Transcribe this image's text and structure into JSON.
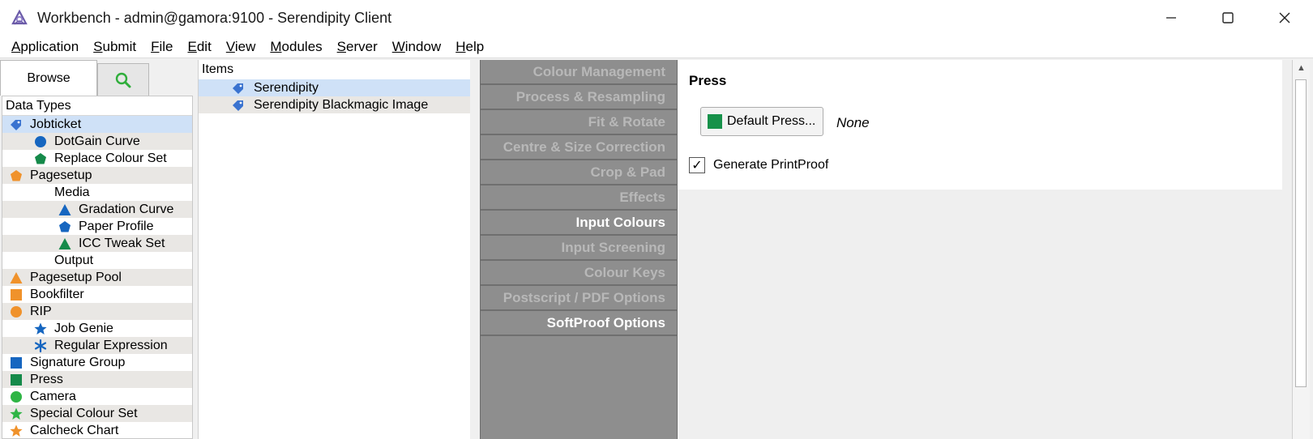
{
  "window": {
    "title": "Workbench - admin@gamora:9100 - Serendipity Client"
  },
  "menu": [
    {
      "u": "A",
      "rest": "pplication"
    },
    {
      "u": "S",
      "rest": "ubmit"
    },
    {
      "u": "F",
      "rest": "ile"
    },
    {
      "u": "E",
      "rest": "dit"
    },
    {
      "u": "V",
      "rest": "iew"
    },
    {
      "u": "M",
      "rest": "odules"
    },
    {
      "u": "S",
      "rest": "erver"
    },
    {
      "u": "W",
      "rest": "indow"
    },
    {
      "u": "H",
      "rest": "elp"
    }
  ],
  "tabs": {
    "browse": "Browse"
  },
  "types": {
    "header": "Data Types",
    "rows": [
      {
        "label": "Jobticket",
        "icon": "tag-icon",
        "color": "#3a73d0"
      },
      {
        "label": "DotGain Curve",
        "icon": "circle-icon",
        "color": "#1666c0"
      },
      {
        "label": "Replace Colour Set",
        "icon": "pentagon-icon",
        "color": "#158a4a"
      },
      {
        "label": "Pagesetup",
        "icon": "pentagon-icon",
        "color": "#f0922b"
      },
      {
        "label": "Media",
        "icon": "crescent-icon",
        "color": "#158a4a"
      },
      {
        "label": "Gradation Curve",
        "icon": "triangle-icon",
        "color": "#1666c0"
      },
      {
        "label": "Paper Profile",
        "icon": "pentagon-icon",
        "color": "#1666c0"
      },
      {
        "label": "ICC Tweak Set",
        "icon": "triangle-icon",
        "color": "#158a4a"
      },
      {
        "label": "Output",
        "icon": "crescent-icon",
        "color": "#f0922b"
      },
      {
        "label": "Pagesetup Pool",
        "icon": "triangle-icon",
        "color": "#f0922b"
      },
      {
        "label": "Bookfilter",
        "icon": "square-icon",
        "color": "#f0922b"
      },
      {
        "label": "RIP",
        "icon": "circle-icon",
        "color": "#f0922b"
      },
      {
        "label": "Job Genie",
        "icon": "star-icon",
        "color": "#1666c0"
      },
      {
        "label": "Regular Expression",
        "icon": "asterisk-icon",
        "color": "#1666c0"
      },
      {
        "label": "Signature Group",
        "icon": "square-icon",
        "color": "#1666c0"
      },
      {
        "label": "Press",
        "icon": "square-icon",
        "color": "#158a4a"
      },
      {
        "label": "Camera",
        "icon": "circle-icon",
        "color": "#2fb545"
      },
      {
        "label": "Special Colour Set",
        "icon": "star-icon",
        "color": "#2fb545"
      },
      {
        "label": "Calcheck Chart",
        "icon": "star-icon",
        "color": "#f0922b"
      }
    ]
  },
  "items": {
    "header": "Items",
    "rows": [
      {
        "label": "Serendipity"
      },
      {
        "label": "Serendipity Blackmagic Image"
      }
    ]
  },
  "nav": [
    {
      "label": "Colour Management",
      "active": false
    },
    {
      "label": "Process & Resampling",
      "active": false
    },
    {
      "label": "Fit & Rotate",
      "active": false
    },
    {
      "label": "Centre & Size Correction",
      "active": false
    },
    {
      "label": "Crop & Pad",
      "active": false
    },
    {
      "label": "Effects",
      "active": false
    },
    {
      "label": "Input Colours",
      "active": true
    },
    {
      "label": "Input Screening",
      "active": false
    },
    {
      "label": "Colour Keys",
      "active": false
    },
    {
      "label": "Postscript / PDF Options",
      "active": false
    },
    {
      "label": "SoftProof Options",
      "active": true
    }
  ],
  "press": {
    "title": "Press",
    "button_label": "Default Press...",
    "value": "None",
    "checkbox_label": "Generate PrintProof",
    "checkbox_checked": true
  }
}
